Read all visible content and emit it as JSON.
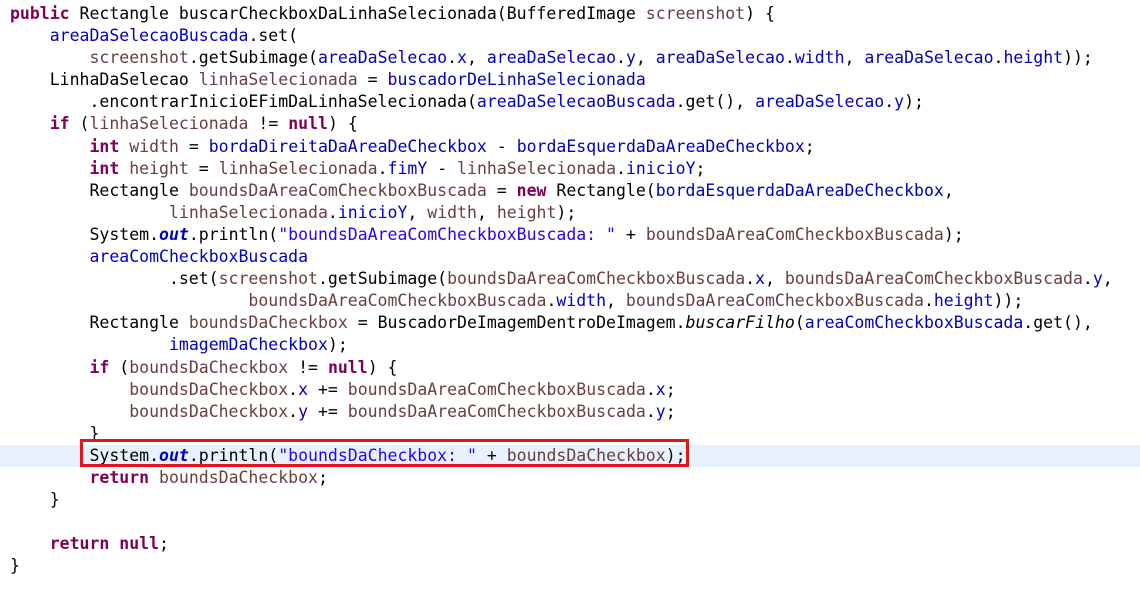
{
  "colors": {
    "keyword": "#7f0055",
    "field": "#0000c0",
    "local_variable": "#6a3e3e",
    "string": "#2a00ff",
    "current_line_background": "#e8f2fe",
    "highlight_box": "#e3141b"
  },
  "highlight": {
    "line": 21,
    "label": "red rectangle around System.out.println line"
  },
  "code_lines": [
    [
      {
        "t": "public",
        "c": "kw"
      },
      {
        "t": " Rectangle buscarCheckboxDaLinhaSelecionada(BufferedImage "
      },
      {
        "t": "screenshot",
        "c": "loc"
      },
      {
        "t": ") {"
      }
    ],
    [
      {
        "t": "    "
      },
      {
        "t": "areaDaSelecaoBuscada",
        "c": "fld"
      },
      {
        "t": ".set("
      }
    ],
    [
      {
        "t": "        "
      },
      {
        "t": "screenshot",
        "c": "loc"
      },
      {
        "t": ".getSubimage("
      },
      {
        "t": "areaDaSelecao",
        "c": "fld"
      },
      {
        "t": "."
      },
      {
        "t": "x",
        "c": "fld"
      },
      {
        "t": ", "
      },
      {
        "t": "areaDaSelecao",
        "c": "fld"
      },
      {
        "t": "."
      },
      {
        "t": "y",
        "c": "fld"
      },
      {
        "t": ", "
      },
      {
        "t": "areaDaSelecao",
        "c": "fld"
      },
      {
        "t": "."
      },
      {
        "t": "width",
        "c": "fld"
      },
      {
        "t": ", "
      },
      {
        "t": "areaDaSelecao",
        "c": "fld"
      },
      {
        "t": "."
      },
      {
        "t": "height",
        "c": "fld"
      },
      {
        "t": "));"
      }
    ],
    [
      {
        "t": "    LinhaDaSelecao "
      },
      {
        "t": "linhaSelecionada",
        "c": "loc"
      },
      {
        "t": " = "
      },
      {
        "t": "buscadorDeLinhaSelecionada",
        "c": "fld"
      }
    ],
    [
      {
        "t": "        .encontrarInicioEFimDaLinhaSelecionada("
      },
      {
        "t": "areaDaSelecaoBuscada",
        "c": "fld"
      },
      {
        "t": ".get(), "
      },
      {
        "t": "areaDaSelecao",
        "c": "fld"
      },
      {
        "t": "."
      },
      {
        "t": "y",
        "c": "fld"
      },
      {
        "t": ");"
      }
    ],
    [
      {
        "t": "    "
      },
      {
        "t": "if",
        "c": "kw"
      },
      {
        "t": " ("
      },
      {
        "t": "linhaSelecionada",
        "c": "loc"
      },
      {
        "t": " != "
      },
      {
        "t": "null",
        "c": "kw"
      },
      {
        "t": ") {"
      }
    ],
    [
      {
        "t": "        "
      },
      {
        "t": "int",
        "c": "kw"
      },
      {
        "t": " "
      },
      {
        "t": "width",
        "c": "loc"
      },
      {
        "t": " = "
      },
      {
        "t": "bordaDireitaDaAreaDeCheckbox",
        "c": "fld"
      },
      {
        "t": " - "
      },
      {
        "t": "bordaEsquerdaDaAreaDeCheckbox",
        "c": "fld"
      },
      {
        "t": ";"
      }
    ],
    [
      {
        "t": "        "
      },
      {
        "t": "int",
        "c": "kw"
      },
      {
        "t": " "
      },
      {
        "t": "height",
        "c": "loc"
      },
      {
        "t": " = "
      },
      {
        "t": "linhaSelecionada",
        "c": "loc"
      },
      {
        "t": "."
      },
      {
        "t": "fimY",
        "c": "fld"
      },
      {
        "t": " - "
      },
      {
        "t": "linhaSelecionada",
        "c": "loc"
      },
      {
        "t": "."
      },
      {
        "t": "inicioY",
        "c": "fld"
      },
      {
        "t": ";"
      }
    ],
    [
      {
        "t": "        Rectangle "
      },
      {
        "t": "boundsDaAreaComCheckboxBuscada",
        "c": "loc"
      },
      {
        "t": " = "
      },
      {
        "t": "new",
        "c": "kw"
      },
      {
        "t": " Rectangle("
      },
      {
        "t": "bordaEsquerdaDaAreaDeCheckbox",
        "c": "fld"
      },
      {
        "t": ","
      }
    ],
    [
      {
        "t": "                "
      },
      {
        "t": "linhaSelecionada",
        "c": "loc"
      },
      {
        "t": "."
      },
      {
        "t": "inicioY",
        "c": "fld"
      },
      {
        "t": ", "
      },
      {
        "t": "width",
        "c": "loc"
      },
      {
        "t": ", "
      },
      {
        "t": "height",
        "c": "loc"
      },
      {
        "t": ");"
      }
    ],
    [
      {
        "t": "        System."
      },
      {
        "t": "out",
        "c": "sfld"
      },
      {
        "t": ".println("
      },
      {
        "t": "\"boundsDaAreaComCheckboxBuscada: \"",
        "c": "str"
      },
      {
        "t": " + "
      },
      {
        "t": "boundsDaAreaComCheckboxBuscada",
        "c": "loc"
      },
      {
        "t": ");"
      }
    ],
    [
      {
        "t": "        "
      },
      {
        "t": "areaComCheckboxBuscada",
        "c": "fld"
      }
    ],
    [
      {
        "t": "                .set("
      },
      {
        "t": "screenshot",
        "c": "loc"
      },
      {
        "t": ".getSubimage("
      },
      {
        "t": "boundsDaAreaComCheckboxBuscada",
        "c": "loc"
      },
      {
        "t": "."
      },
      {
        "t": "x",
        "c": "fld"
      },
      {
        "t": ", "
      },
      {
        "t": "boundsDaAreaComCheckboxBuscada",
        "c": "loc"
      },
      {
        "t": "."
      },
      {
        "t": "y",
        "c": "fld"
      },
      {
        "t": ","
      }
    ],
    [
      {
        "t": "                        "
      },
      {
        "t": "boundsDaAreaComCheckboxBuscada",
        "c": "loc"
      },
      {
        "t": "."
      },
      {
        "t": "width",
        "c": "fld"
      },
      {
        "t": ", "
      },
      {
        "t": "boundsDaAreaComCheckboxBuscada",
        "c": "loc"
      },
      {
        "t": "."
      },
      {
        "t": "height",
        "c": "fld"
      },
      {
        "t": "));"
      }
    ],
    [
      {
        "t": "        Rectangle "
      },
      {
        "t": "boundsDaCheckbox",
        "c": "loc"
      },
      {
        "t": " = BuscadorDeImagemDentroDeImagem."
      },
      {
        "t": "buscarFilho",
        "c": "smth"
      },
      {
        "t": "("
      },
      {
        "t": "areaComCheckboxBuscada",
        "c": "fld"
      },
      {
        "t": ".get(),"
      }
    ],
    [
      {
        "t": "                "
      },
      {
        "t": "imagemDaCheckbox",
        "c": "fld"
      },
      {
        "t": ");"
      }
    ],
    [
      {
        "t": "        "
      },
      {
        "t": "if",
        "c": "kw"
      },
      {
        "t": " ("
      },
      {
        "t": "boundsDaCheckbox",
        "c": "loc"
      },
      {
        "t": " != "
      },
      {
        "t": "null",
        "c": "kw"
      },
      {
        "t": ") {"
      }
    ],
    [
      {
        "t": "            "
      },
      {
        "t": "boundsDaCheckbox",
        "c": "loc"
      },
      {
        "t": "."
      },
      {
        "t": "x",
        "c": "fld"
      },
      {
        "t": " += "
      },
      {
        "t": "boundsDaAreaComCheckboxBuscada",
        "c": "loc"
      },
      {
        "t": "."
      },
      {
        "t": "x",
        "c": "fld"
      },
      {
        "t": ";"
      }
    ],
    [
      {
        "t": "            "
      },
      {
        "t": "boundsDaCheckbox",
        "c": "loc"
      },
      {
        "t": "."
      },
      {
        "t": "y",
        "c": "fld"
      },
      {
        "t": " += "
      },
      {
        "t": "boundsDaAreaComCheckboxBuscada",
        "c": "loc"
      },
      {
        "t": "."
      },
      {
        "t": "y",
        "c": "fld"
      },
      {
        "t": ";"
      }
    ],
    [
      {
        "t": "        }"
      }
    ],
    [
      {
        "t": "        System."
      },
      {
        "t": "out",
        "c": "sfld"
      },
      {
        "t": ".println("
      },
      {
        "t": "\"boundsDaCheckbox: \"",
        "c": "str"
      },
      {
        "t": " + "
      },
      {
        "t": "boundsDaCheckbox",
        "c": "loc"
      },
      {
        "t": ");"
      }
    ],
    [
      {
        "t": "        "
      },
      {
        "t": "return",
        "c": "kw"
      },
      {
        "t": " "
      },
      {
        "t": "boundsDaCheckbox",
        "c": "loc"
      },
      {
        "t": ";"
      }
    ],
    [
      {
        "t": "    }"
      }
    ],
    [
      {
        "t": ""
      }
    ],
    [
      {
        "t": "    "
      },
      {
        "t": "return",
        "c": "kw"
      },
      {
        "t": " "
      },
      {
        "t": "null",
        "c": "kw"
      },
      {
        "t": ";"
      }
    ],
    [
      {
        "t": "}"
      }
    ]
  ]
}
